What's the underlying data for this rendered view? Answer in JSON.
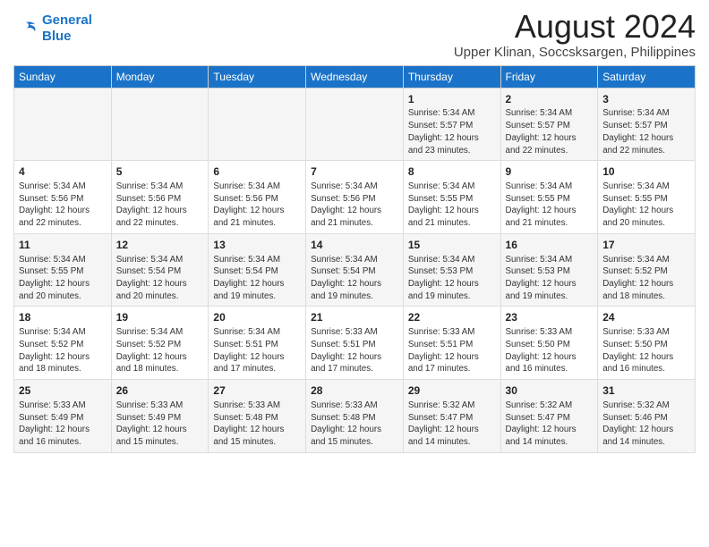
{
  "logo": {
    "line1": "General",
    "line2": "Blue"
  },
  "title": "August 2024",
  "subtitle": "Upper Klinan, Soccsksargen, Philippines",
  "headers": [
    "Sunday",
    "Monday",
    "Tuesday",
    "Wednesday",
    "Thursday",
    "Friday",
    "Saturday"
  ],
  "weeks": [
    [
      {
        "day": "",
        "content": ""
      },
      {
        "day": "",
        "content": ""
      },
      {
        "day": "",
        "content": ""
      },
      {
        "day": "",
        "content": ""
      },
      {
        "day": "1",
        "content": "Sunrise: 5:34 AM\nSunset: 5:57 PM\nDaylight: 12 hours and 23 minutes."
      },
      {
        "day": "2",
        "content": "Sunrise: 5:34 AM\nSunset: 5:57 PM\nDaylight: 12 hours and 22 minutes."
      },
      {
        "day": "3",
        "content": "Sunrise: 5:34 AM\nSunset: 5:57 PM\nDaylight: 12 hours and 22 minutes."
      }
    ],
    [
      {
        "day": "4",
        "content": "Sunrise: 5:34 AM\nSunset: 5:56 PM\nDaylight: 12 hours and 22 minutes."
      },
      {
        "day": "5",
        "content": "Sunrise: 5:34 AM\nSunset: 5:56 PM\nDaylight: 12 hours and 22 minutes."
      },
      {
        "day": "6",
        "content": "Sunrise: 5:34 AM\nSunset: 5:56 PM\nDaylight: 12 hours and 21 minutes."
      },
      {
        "day": "7",
        "content": "Sunrise: 5:34 AM\nSunset: 5:56 PM\nDaylight: 12 hours and 21 minutes."
      },
      {
        "day": "8",
        "content": "Sunrise: 5:34 AM\nSunset: 5:55 PM\nDaylight: 12 hours and 21 minutes."
      },
      {
        "day": "9",
        "content": "Sunrise: 5:34 AM\nSunset: 5:55 PM\nDaylight: 12 hours and 21 minutes."
      },
      {
        "day": "10",
        "content": "Sunrise: 5:34 AM\nSunset: 5:55 PM\nDaylight: 12 hours and 20 minutes."
      }
    ],
    [
      {
        "day": "11",
        "content": "Sunrise: 5:34 AM\nSunset: 5:55 PM\nDaylight: 12 hours and 20 minutes."
      },
      {
        "day": "12",
        "content": "Sunrise: 5:34 AM\nSunset: 5:54 PM\nDaylight: 12 hours and 20 minutes."
      },
      {
        "day": "13",
        "content": "Sunrise: 5:34 AM\nSunset: 5:54 PM\nDaylight: 12 hours and 19 minutes."
      },
      {
        "day": "14",
        "content": "Sunrise: 5:34 AM\nSunset: 5:54 PM\nDaylight: 12 hours and 19 minutes."
      },
      {
        "day": "15",
        "content": "Sunrise: 5:34 AM\nSunset: 5:53 PM\nDaylight: 12 hours and 19 minutes."
      },
      {
        "day": "16",
        "content": "Sunrise: 5:34 AM\nSunset: 5:53 PM\nDaylight: 12 hours and 19 minutes."
      },
      {
        "day": "17",
        "content": "Sunrise: 5:34 AM\nSunset: 5:52 PM\nDaylight: 12 hours and 18 minutes."
      }
    ],
    [
      {
        "day": "18",
        "content": "Sunrise: 5:34 AM\nSunset: 5:52 PM\nDaylight: 12 hours and 18 minutes."
      },
      {
        "day": "19",
        "content": "Sunrise: 5:34 AM\nSunset: 5:52 PM\nDaylight: 12 hours and 18 minutes."
      },
      {
        "day": "20",
        "content": "Sunrise: 5:34 AM\nSunset: 5:51 PM\nDaylight: 12 hours and 17 minutes."
      },
      {
        "day": "21",
        "content": "Sunrise: 5:33 AM\nSunset: 5:51 PM\nDaylight: 12 hours and 17 minutes."
      },
      {
        "day": "22",
        "content": "Sunrise: 5:33 AM\nSunset: 5:51 PM\nDaylight: 12 hours and 17 minutes."
      },
      {
        "day": "23",
        "content": "Sunrise: 5:33 AM\nSunset: 5:50 PM\nDaylight: 12 hours and 16 minutes."
      },
      {
        "day": "24",
        "content": "Sunrise: 5:33 AM\nSunset: 5:50 PM\nDaylight: 12 hours and 16 minutes."
      }
    ],
    [
      {
        "day": "25",
        "content": "Sunrise: 5:33 AM\nSunset: 5:49 PM\nDaylight: 12 hours and 16 minutes."
      },
      {
        "day": "26",
        "content": "Sunrise: 5:33 AM\nSunset: 5:49 PM\nDaylight: 12 hours and 15 minutes."
      },
      {
        "day": "27",
        "content": "Sunrise: 5:33 AM\nSunset: 5:48 PM\nDaylight: 12 hours and 15 minutes."
      },
      {
        "day": "28",
        "content": "Sunrise: 5:33 AM\nSunset: 5:48 PM\nDaylight: 12 hours and 15 minutes."
      },
      {
        "day": "29",
        "content": "Sunrise: 5:32 AM\nSunset: 5:47 PM\nDaylight: 12 hours and 14 minutes."
      },
      {
        "day": "30",
        "content": "Sunrise: 5:32 AM\nSunset: 5:47 PM\nDaylight: 12 hours and 14 minutes."
      },
      {
        "day": "31",
        "content": "Sunrise: 5:32 AM\nSunset: 5:46 PM\nDaylight: 12 hours and 14 minutes."
      }
    ]
  ]
}
